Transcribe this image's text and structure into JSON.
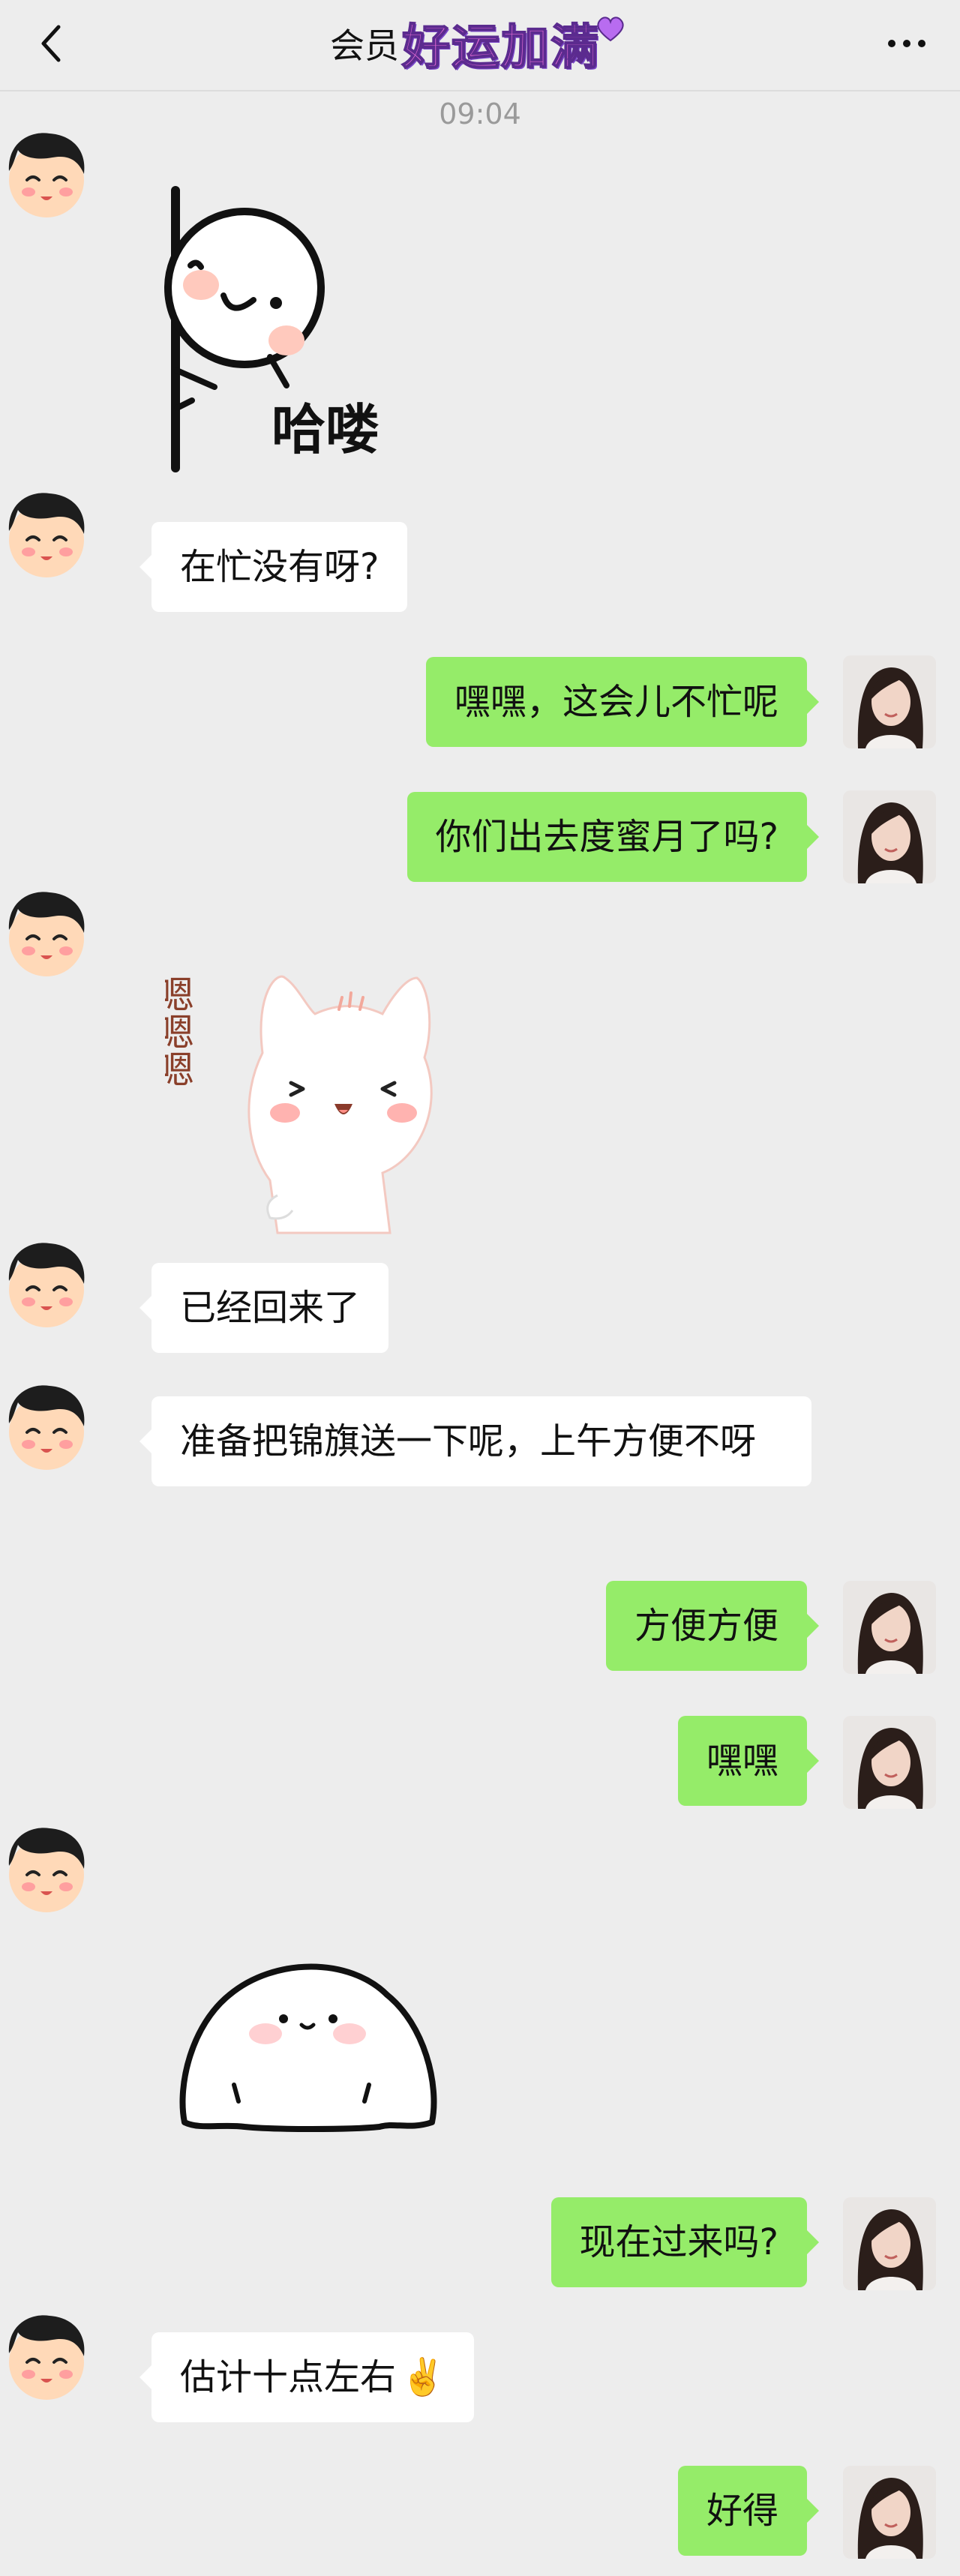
{
  "header": {
    "title": "会员",
    "title_sticker": "好运加满",
    "back_icon": "chevron-left-icon",
    "more_icon": "ellipsis-icon"
  },
  "timestamp": "09:04",
  "messages": [
    {
      "side": "left",
      "type": "sticker",
      "sticker": "peek-hello-sticker",
      "text": "哈喽"
    },
    {
      "side": "left",
      "type": "text",
      "text": "在忙没有呀?"
    },
    {
      "side": "right",
      "type": "text",
      "text": "嘿嘿，这会儿不忙呢"
    },
    {
      "side": "right",
      "type": "text",
      "text": "你们出去度蜜月了吗?"
    },
    {
      "side": "left",
      "type": "sticker",
      "sticker": "cat-nod-sticker",
      "text": "嗯嗯嗯"
    },
    {
      "side": "left",
      "type": "text",
      "text": "已经回来了"
    },
    {
      "side": "left",
      "type": "text",
      "text": "准备把锦旗送一下呢，上午方便不呀"
    },
    {
      "side": "right",
      "type": "text",
      "text": "方便方便"
    },
    {
      "side": "right",
      "type": "text",
      "text": "嘿嘿"
    },
    {
      "side": "left",
      "type": "sticker",
      "sticker": "ghost-blob-sticker",
      "text": ""
    },
    {
      "side": "right",
      "type": "text",
      "text": "现在过来吗?"
    },
    {
      "side": "left",
      "type": "text",
      "text": "估计十点左右",
      "emoji": "✌️"
    },
    {
      "side": "right",
      "type": "text",
      "text": "好得"
    }
  ],
  "colors": {
    "background": "#ededed",
    "bubble_self": "#95ec69",
    "bubble_other": "#ffffff"
  }
}
